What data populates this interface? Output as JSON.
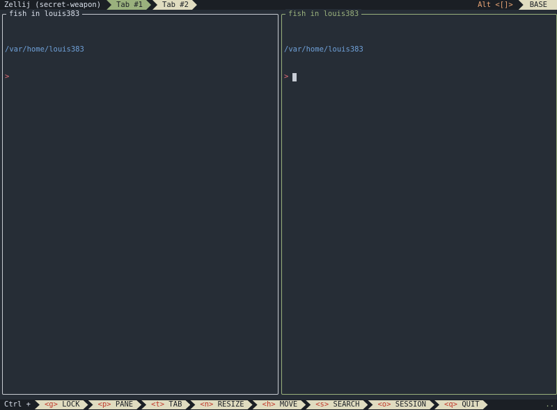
{
  "topbar": {
    "session_name": "Zellij (secret-weapon)",
    "tabs": [
      {
        "label": "Tab #1",
        "active": true
      },
      {
        "label": "Tab #2",
        "active": false
      }
    ],
    "alt_hint_prefix": "Alt",
    "alt_hint_keys": "<[]>",
    "mode": "BASE"
  },
  "panes": {
    "left": {
      "title": "fish in louis383",
      "cwd": "/var/home/louis383",
      "prompt": ">"
    },
    "right": {
      "title": "fish in louis383",
      "cwd": "/var/home/louis383",
      "prompt": ">"
    }
  },
  "statusbar": {
    "modifier": "Ctrl +",
    "keys": [
      {
        "key": "<g>",
        "label": "LOCK"
      },
      {
        "key": "<p>",
        "label": "PANE"
      },
      {
        "key": "<t>",
        "label": "TAB"
      },
      {
        "key": "<n>",
        "label": "RESIZE"
      },
      {
        "key": "<h>",
        "label": "MOVE"
      },
      {
        "key": "<s>",
        "label": "SEARCH"
      },
      {
        "key": "<o>",
        "label": "SESSION"
      },
      {
        "key": "<q>",
        "label": "QUIT"
      }
    ],
    "overflow": ".."
  },
  "colors": {
    "background": "#262d36",
    "bar_background": "#1b1f25",
    "active_accent": "#9ab17d",
    "inactive_tab": "#e0dcc0",
    "path_blue": "#6fa0d8",
    "key_red": "#c0392b",
    "alt_orange": "#e9a474"
  }
}
